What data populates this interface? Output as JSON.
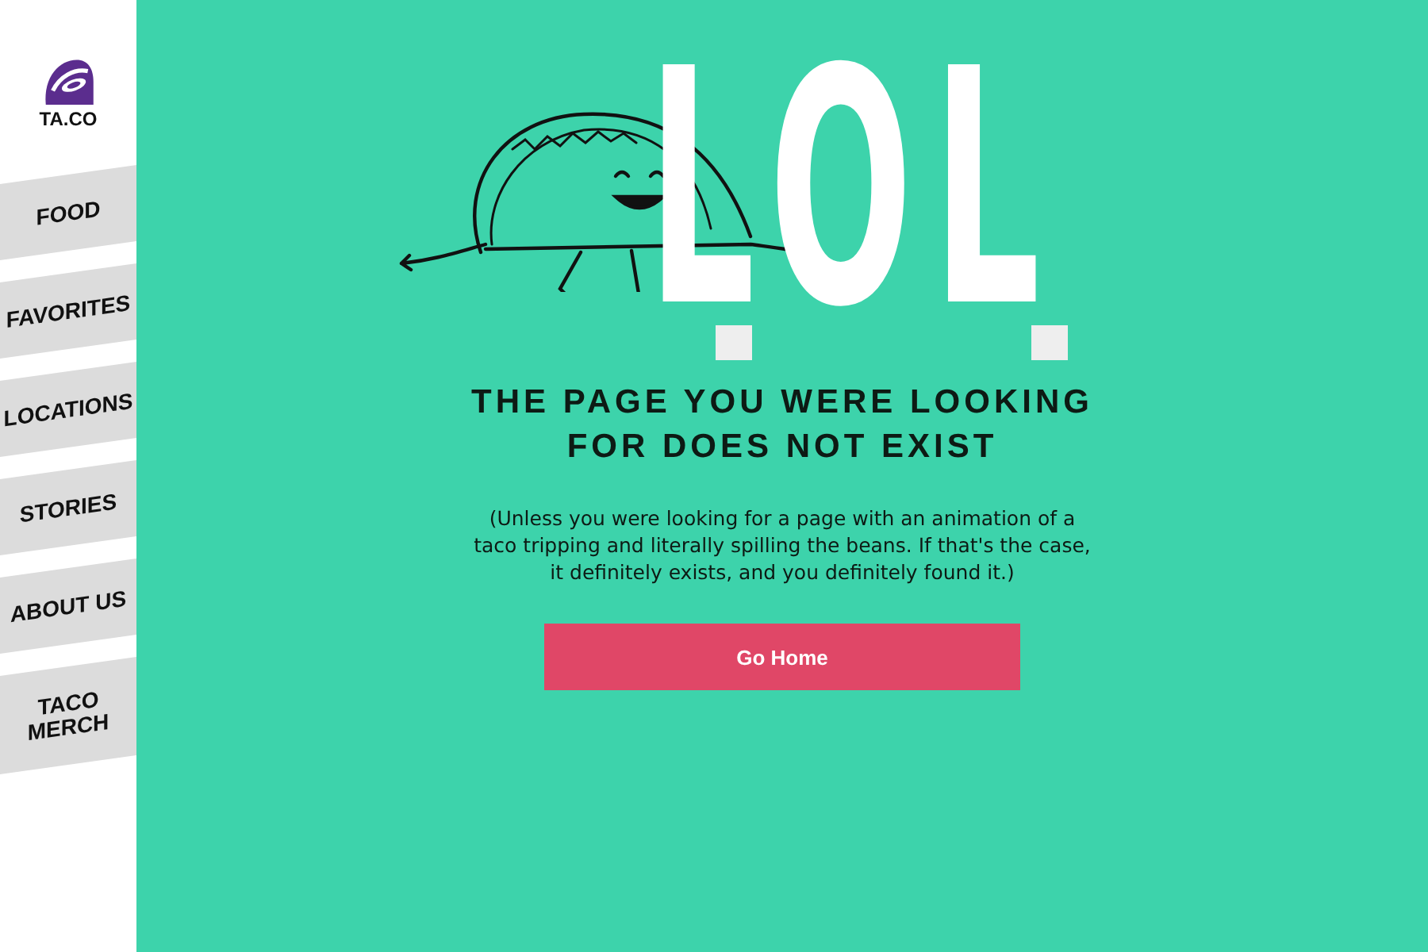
{
  "logo": {
    "text": "TA.CO"
  },
  "nav": [
    {
      "label": "FOOD"
    },
    {
      "label": "FAVORITES"
    },
    {
      "label": "LOCATIONS"
    },
    {
      "label": "STORIES"
    },
    {
      "label": "ABOUT US"
    },
    {
      "label": "TACO\nMERCH"
    }
  ],
  "hero": {
    "big_text": "LOL"
  },
  "heading": "THE PAGE YOU WERE LOOKING\nFOR DOES NOT EXIST",
  "message": "(Unless you were looking for a page with an animation of a taco tripping and literally spilling the beans. If that's the case, it definitely exists, and you definitely found it.)",
  "button": {
    "label": "Go Home"
  }
}
